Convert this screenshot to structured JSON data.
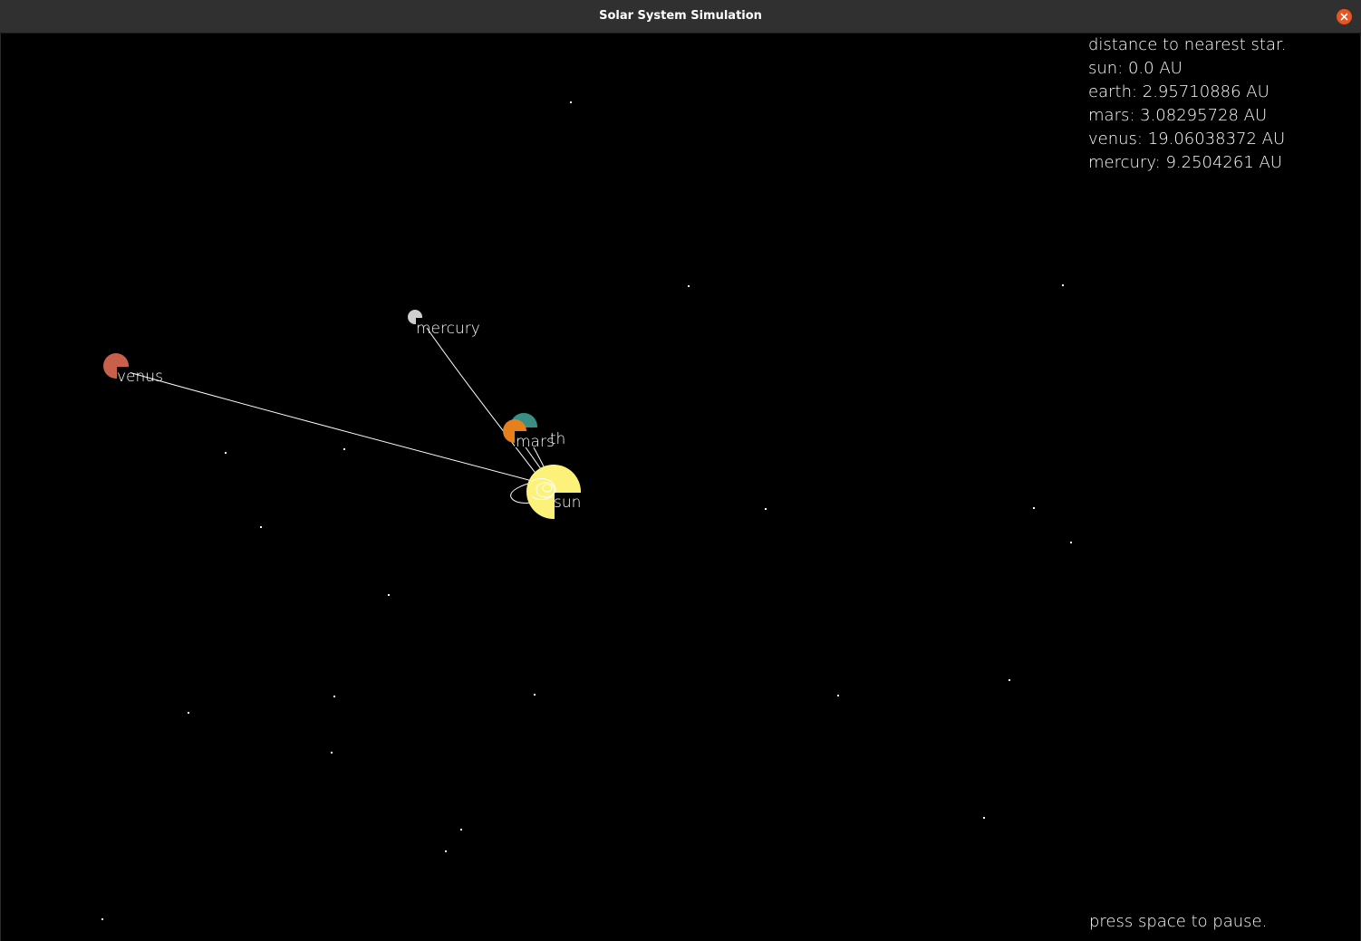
{
  "window": {
    "title": "Solar System Simulation"
  },
  "hud": {
    "heading": "distance to nearest star.",
    "rows": [
      {
        "name": "sun",
        "text": "sun: 0.0 AU"
      },
      {
        "name": "earth",
        "text": "earth: 2.95710886 AU"
      },
      {
        "name": "mars",
        "text": "mars: 3.08295728 AU"
      },
      {
        "name": "venus",
        "text": "venus: 19.06038372 AU"
      },
      {
        "name": "mercury",
        "text": "mercury: 9.2504261 AU"
      }
    ]
  },
  "hint": "press space to pause.",
  "bodies": {
    "sun": {
      "label": "sun",
      "color": "#fcf27a"
    },
    "earth": {
      "label": "earth",
      "color": "#3a8f85"
    },
    "mars": {
      "label": "mars",
      "color": "#e6801c"
    },
    "venus": {
      "label": "venus",
      "color": "#c8604a"
    },
    "mercury": {
      "label": "mercury",
      "color": "#cfcfcf"
    }
  },
  "colors": {
    "background": "#000000",
    "titlebar": "#303030",
    "close_button": "#e95420",
    "text": "#ffffff"
  }
}
